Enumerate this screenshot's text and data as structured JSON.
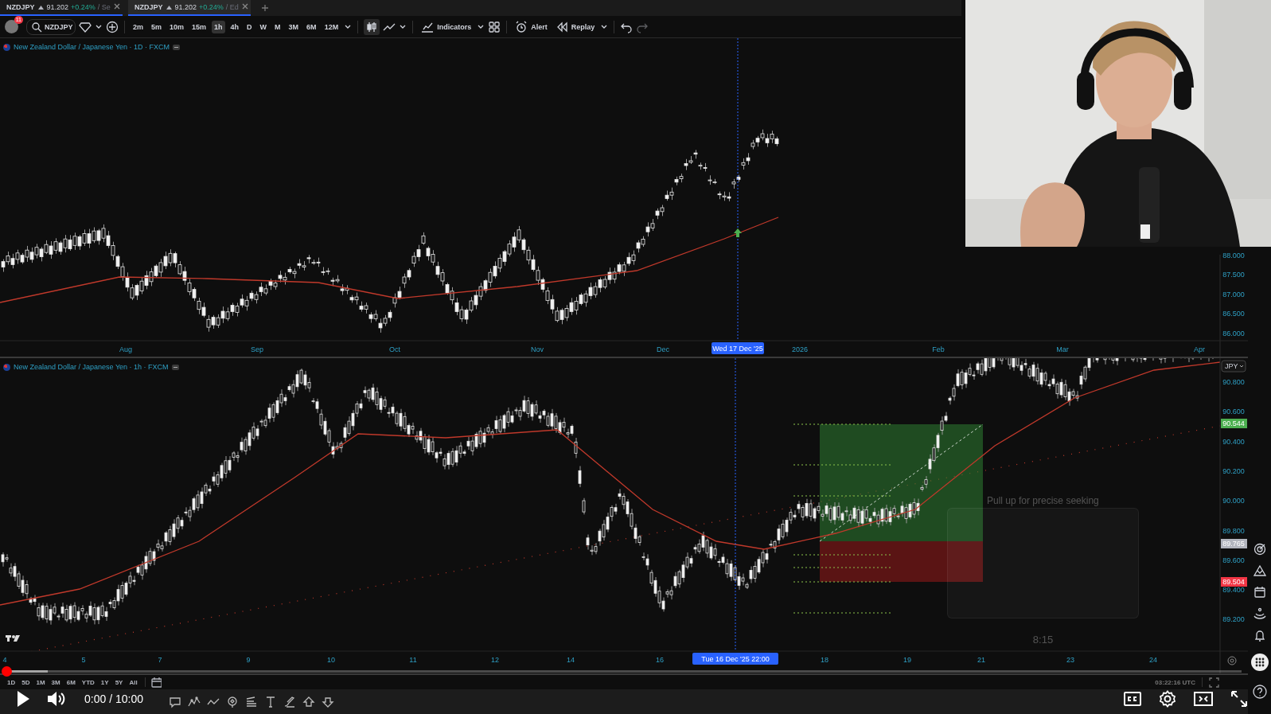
{
  "tabs": [
    {
      "symbol": "NZDJPY",
      "price": "91.202",
      "change": "+0.24%",
      "suffix": "/ Se",
      "selected": false
    },
    {
      "symbol": "NZDJPY",
      "price": "91.202",
      "change": "+0.24%",
      "suffix": "/ Ed",
      "selected": true
    }
  ],
  "toolbar": {
    "notification_count": "11",
    "symbol": "NZDJPY",
    "intervals": [
      {
        "label": "2m",
        "selected": false
      },
      {
        "label": "5m",
        "selected": false
      },
      {
        "label": "10m",
        "selected": false
      },
      {
        "label": "15m",
        "selected": false
      },
      {
        "label": "1h",
        "selected": true
      },
      {
        "label": "4h",
        "selected": false
      },
      {
        "label": "D",
        "selected": false
      },
      {
        "label": "W",
        "selected": false
      },
      {
        "label": "M",
        "selected": false
      },
      {
        "label": "3M",
        "selected": false
      },
      {
        "label": "6M",
        "selected": false
      },
      {
        "label": "12M",
        "selected": false
      }
    ],
    "buttons": [
      {
        "label": "Indicators"
      },
      {
        "label": "Alert"
      },
      {
        "label": "Replay"
      }
    ]
  },
  "panes": [
    {
      "legend": "New Zealand Dollar / Japanese Yen · 1D · FXCM",
      "x_labels": [
        "Aug",
        "Sep",
        "Oct",
        "Nov",
        "Dec",
        "2026",
        "Feb",
        "Mar",
        "Apr"
      ],
      "y_labels": [
        "88.000",
        "87.500",
        "87.000",
        "86.500",
        "86.000"
      ],
      "crosshair_label": "Wed 17 Dec '25"
    },
    {
      "legend": "New Zealand Dollar / Japanese Yen · 1h · FXCM",
      "currency": "JPY",
      "x_labels": [
        "4",
        "5",
        "7",
        "9",
        "10",
        "11",
        "12",
        "14",
        "16",
        "18",
        "19",
        "21",
        "23",
        "24"
      ],
      "y_labels": [
        "90.800",
        "90.600",
        "90.400",
        "90.200",
        "90.000",
        "89.800",
        "89.600",
        "89.400",
        "89.200"
      ],
      "price_tags": [
        {
          "text": "90.544",
          "color": "#4caf50"
        },
        {
          "text": "89.765",
          "color": "#b2b5be"
        },
        {
          "text": "89.504",
          "color": "#f23645"
        }
      ],
      "crosshair_label": "Tue 16 Dec '25 22:00"
    }
  ],
  "range_bar": {
    "ranges": [
      "1D",
      "5D",
      "1M",
      "3M",
      "6M",
      "YTD",
      "1Y",
      "5Y",
      "All"
    ],
    "clock": "03:22:16 UTC"
  },
  "player": {
    "time": "0:00 / 10:00",
    "progress": {
      "level": 0
    },
    "seek_hint": "Pull up for precise seeking",
    "preview_time": "8:15"
  }
}
